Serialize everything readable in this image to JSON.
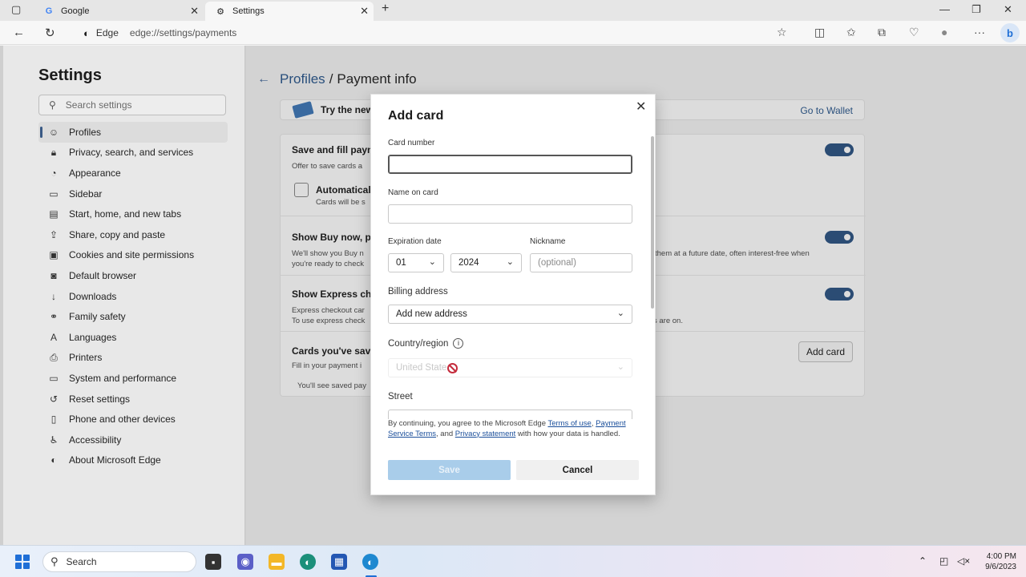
{
  "browser": {
    "tabs": [
      {
        "label": "Google",
        "icon": "google-icon"
      },
      {
        "label": "Settings",
        "icon": "gear-icon",
        "active": true
      }
    ],
    "new_tab": "+",
    "address": {
      "label": "Edge",
      "url": "edge://settings/payments"
    }
  },
  "sidebar": {
    "title": "Settings",
    "search_placeholder": "Search settings",
    "items": [
      {
        "label": "Profiles",
        "icon": "profile-icon",
        "selected": true
      },
      {
        "label": "Privacy, search, and services",
        "icon": "lock-icon"
      },
      {
        "label": "Appearance",
        "icon": "appearance-icon"
      },
      {
        "label": "Sidebar",
        "icon": "sidebar-icon"
      },
      {
        "label": "Start, home, and new tabs",
        "icon": "home-icon"
      },
      {
        "label": "Share, copy and paste",
        "icon": "share-icon"
      },
      {
        "label": "Cookies and site permissions",
        "icon": "cookie-icon"
      },
      {
        "label": "Default browser",
        "icon": "browser-icon"
      },
      {
        "label": "Downloads",
        "icon": "download-icon"
      },
      {
        "label": "Family safety",
        "icon": "family-icon"
      },
      {
        "label": "Languages",
        "icon": "language-icon"
      },
      {
        "label": "Printers",
        "icon": "printer-icon"
      },
      {
        "label": "System and performance",
        "icon": "system-icon"
      },
      {
        "label": "Reset settings",
        "icon": "reset-icon"
      },
      {
        "label": "Phone and other devices",
        "icon": "phone-icon"
      },
      {
        "label": "Accessibility",
        "icon": "accessibility-icon"
      },
      {
        "label": "About Microsoft Edge",
        "icon": "edge-icon"
      }
    ]
  },
  "main": {
    "breadcrumb": {
      "parent": "Profiles",
      "separator": "/",
      "current": "Payment info"
    },
    "banner": {
      "text": "Try the new",
      "link": "Go to Wallet"
    },
    "sections": {
      "save_fill_title": "Save and fill paym",
      "save_fill_desc": "Offer to save cards a",
      "auto_title": "Automatical",
      "auto_desc": "Cards will be s",
      "buy_now_title": "Show Buy now, pa",
      "buy_now_desc1": "We'll show you Buy n",
      "buy_now_desc1_tail": "them at a future date, often interest-free when",
      "buy_now_desc2": "you're ready to check",
      "express_title": "Show Express che",
      "express_desc1": "Express checkout car",
      "express_desc2": "To use express check",
      "express_desc2_tail": "s are on.",
      "cards_title": "Cards you've save",
      "cards_desc": "Fill in your payment i",
      "cards_empty": "You'll see saved pay",
      "add_card_button": "Add card"
    }
  },
  "dialog": {
    "title": "Add card",
    "card_number_label": "Card number",
    "card_number_value": "",
    "name_label": "Name on card",
    "name_value": "",
    "expiration_label": "Expiration date",
    "exp_month": "01",
    "exp_year": "2024",
    "nickname_label": "Nickname",
    "nickname_placeholder": "(optional)",
    "billing_label": "Billing address",
    "billing_value": "Add new address",
    "country_label": "Country/region",
    "country_value": "United State",
    "street_label": "Street",
    "legal_prefix": "By continuing, you agree to the Microsoft Edge ",
    "terms_link": "Terms of use",
    "legal_comma": ",",
    "payment_terms_link": "Payment Service Terms",
    "legal_and": ", and ",
    "privacy_link": "Privacy statement",
    "legal_suffix": " with how your data is handled.",
    "save_button": "Save",
    "cancel_button": "Cancel"
  },
  "taskbar": {
    "search_label": "Search",
    "time": "4:00 PM",
    "date": "9/6/2023"
  },
  "colors": {
    "accent": "#2b4c74",
    "link": "#294f7c",
    "save_disabled": "#a9cdea",
    "windows_blue": "#1f6fd6"
  }
}
